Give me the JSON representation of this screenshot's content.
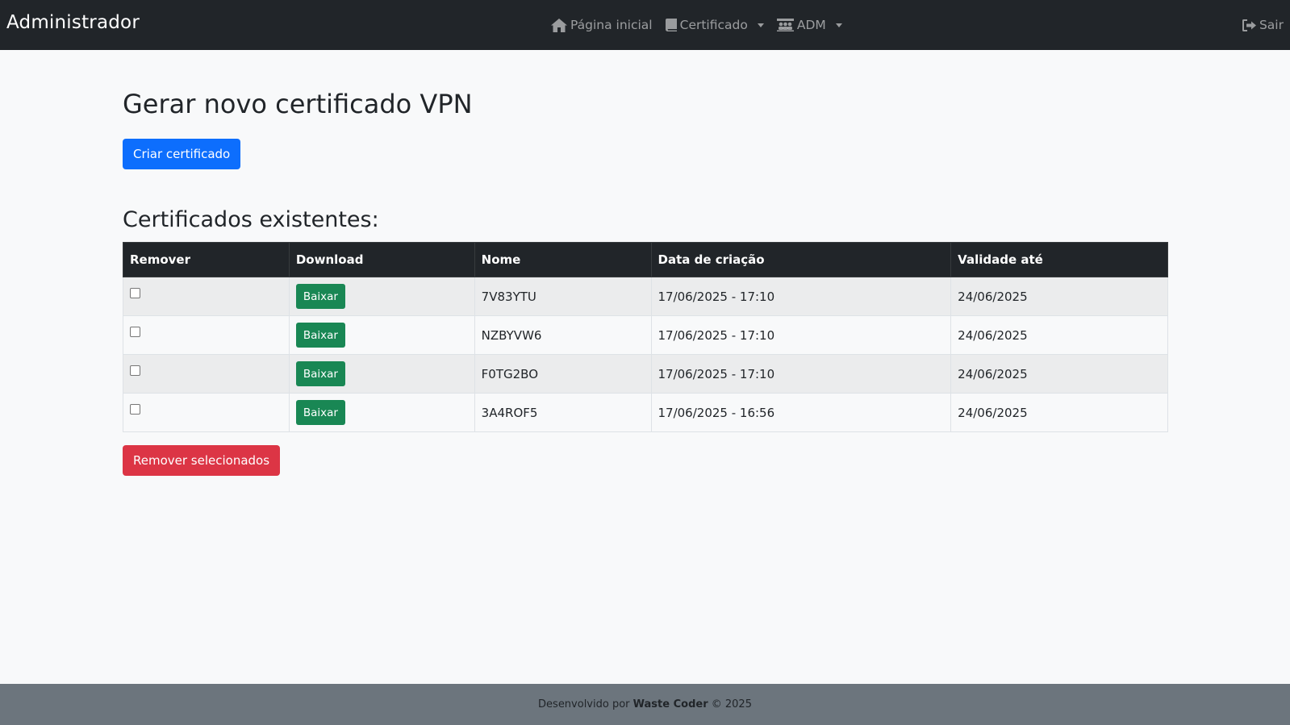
{
  "navbar": {
    "brand": "Administrador",
    "links": [
      {
        "label": "Página inicial",
        "icon": "home-icon"
      },
      {
        "label": "Certificado",
        "icon": "book-icon",
        "dropdown": true
      },
      {
        "label": "ADM",
        "icon": "users-icon",
        "dropdown": true
      }
    ],
    "logout": {
      "label": "Sair",
      "icon": "sign-out-icon"
    }
  },
  "main": {
    "title": "Gerar novo certificado VPN",
    "create_button": "Criar certificado",
    "list_title": "Certificados existentes:",
    "table": {
      "headers": [
        "Remover",
        "Download",
        "Nome",
        "Data de criação",
        "Validade até"
      ],
      "download_label": "Baixar",
      "rows": [
        {
          "name": "7V83YTU",
          "created": "17/06/2025 - 17:10",
          "valid_until": "24/06/2025",
          "selected": false
        },
        {
          "name": "NZBYVW6",
          "created": "17/06/2025 - 17:10",
          "valid_until": "24/06/2025",
          "selected": false
        },
        {
          "name": "F0TG2BO",
          "created": "17/06/2025 - 17:10",
          "valid_until": "24/06/2025",
          "selected": false
        },
        {
          "name": "3A4ROF5",
          "created": "17/06/2025 - 16:56",
          "valid_until": "24/06/2025",
          "selected": false
        }
      ]
    },
    "remove_button": "Remover selecionados"
  },
  "footer": {
    "prefix": "Desenvolvido por",
    "author": "Waste Coder",
    "suffix": "© 2025"
  },
  "colors": {
    "navbar_bg": "#212529",
    "primary": "#0d6efd",
    "success": "#198754",
    "danger": "#dc3545",
    "footer_bg": "#6c757d"
  }
}
